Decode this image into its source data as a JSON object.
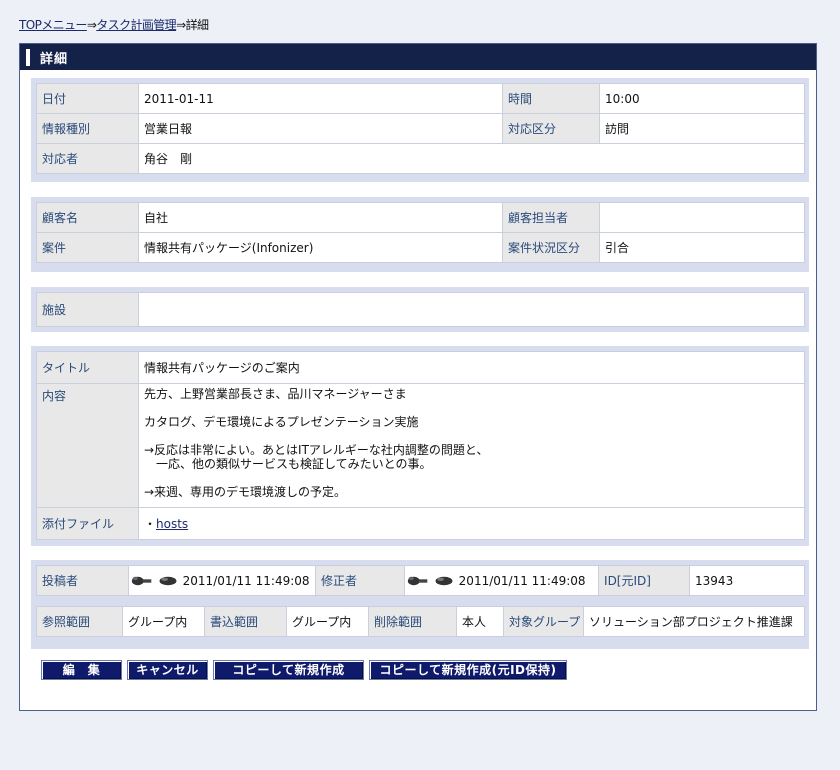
{
  "breadcrumb": {
    "top_menu": "TOPメニュー",
    "sep1": "⇒",
    "task_plan": "タスク計画管理",
    "sep2": "⇒",
    "current": "詳細"
  },
  "panel": {
    "title": "詳細"
  },
  "section1": {
    "date_label": "日付",
    "date_value": "2011-01-11",
    "time_label": "時間",
    "time_value": "10:00",
    "info_type_label": "情報種別",
    "info_type_value": "営業日報",
    "response_type_label": "対応区分",
    "response_type_value": "訪問",
    "responder_label": "対応者",
    "responder_value": "角谷　剛"
  },
  "section2": {
    "customer_label": "顧客名",
    "customer_value": "自社",
    "contact_label": "顧客担当者",
    "contact_value": "",
    "project_label": "案件",
    "project_value": "情報共有パッケージ(Infonizer)",
    "project_status_label": "案件状況区分",
    "project_status_value": "引合"
  },
  "section3": {
    "facility_label": "施設",
    "facility_value": ""
  },
  "section4": {
    "title_label": "タイトル",
    "title_value": "情報共有パッケージのご案内",
    "content_label": "内容",
    "content_lines": [
      "先方、上野営業部長さま、品川マネージャーさま",
      "",
      "カタログ、デモ環境によるプレゼンテーション実施",
      "",
      "→反応は非常によい。あとはITアレルギーな社内調整の問題と、",
      "　一応、他の類似サービスも検証してみたいとの事。",
      "",
      "→来週、専用のデモ環境渡しの予定。"
    ],
    "attachment_label": "添付ファイル",
    "attachment_bullet": "・",
    "attachment_file": "hosts"
  },
  "section5": {
    "poster_label": "投稿者",
    "poster_time": "2011/01/11 11:49:08",
    "modifier_label": "修正者",
    "modifier_time": "2011/01/11 11:49:08",
    "id_label": "ID[元ID]",
    "id_value": "13943",
    "ref_label": "参照範囲",
    "ref_value": "グループ内",
    "write_label": "書込範囲",
    "write_value": "グループ内",
    "delete_label": "削除範囲",
    "delete_value": "本人",
    "target_label": "対象グループ",
    "target_value": "ソリューション部プロジェクト推進課"
  },
  "buttons": {
    "edit": "編　集",
    "cancel": "キャンセル",
    "copy_new": "コピーして新規作成",
    "copy_new_keep": "コピーして新規作成(元ID保持)"
  },
  "colors": {
    "header_bg": "#14224a",
    "block_bg": "#d7ddef",
    "label_bg": "#e8e8e8",
    "button_bg": "#0f1a6a"
  }
}
